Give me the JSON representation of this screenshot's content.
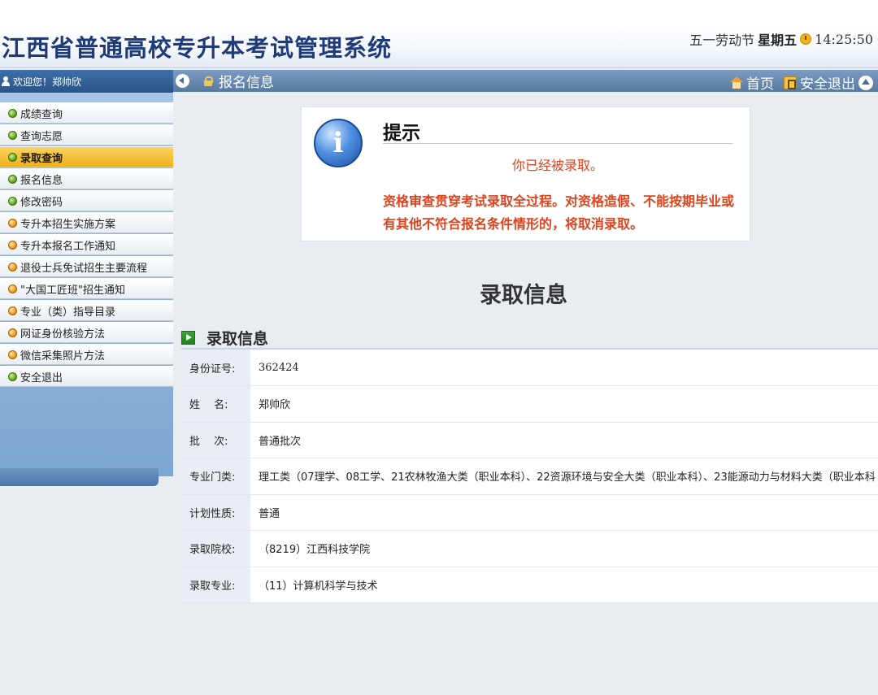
{
  "header": {
    "title": "江西省普通高校专升本考试管理系统",
    "holiday": "五一劳动节",
    "weekday": "星期五",
    "time": "14:25:50"
  },
  "sidebar": {
    "welcome": "欢迎您！郑帅欣",
    "items": [
      {
        "label": "成绩查询",
        "bullet": "green"
      },
      {
        "label": "查询志愿",
        "bullet": "green"
      },
      {
        "label": "录取查询",
        "bullet": "green",
        "active": true
      },
      {
        "label": "报名信息",
        "bullet": "green"
      },
      {
        "label": "修改密码",
        "bullet": "green"
      },
      {
        "label": "专升本招生实施方案",
        "bullet": "orange"
      },
      {
        "label": "专升本报名工作通知",
        "bullet": "orange"
      },
      {
        "label": "退役士兵免试招生主要流程",
        "bullet": "orange"
      },
      {
        "label": "\"大国工匠班\"招生通知",
        "bullet": "orange"
      },
      {
        "label": "专业（类）指导目录",
        "bullet": "orange"
      },
      {
        "label": "网证身份核验方法",
        "bullet": "orange"
      },
      {
        "label": "微信采集照片方法",
        "bullet": "orange"
      },
      {
        "label": "安全退出",
        "bullet": "green"
      }
    ]
  },
  "content_bar": {
    "breadcrumb": "报名信息",
    "home": "首页",
    "logout": "安全退出"
  },
  "notice": {
    "title": "提示",
    "message": "你已经被录取。",
    "detail": "资格审查贯穿考试录取全过程。对资格造假、不能按期毕业或有其他不符合报名条件情形的，将取消录取。"
  },
  "page_heading": "录取信息",
  "admission": {
    "section_title": "录取信息",
    "rows": [
      {
        "label": "身份证号:",
        "value": "362424"
      },
      {
        "label": "姓　 名:",
        "value": "郑帅欣"
      },
      {
        "label": "批　 次:",
        "value": "普通批次"
      },
      {
        "label": "专业门类:",
        "value": "理工类（07理学、08工学、21农林牧渔大类（职业本科）、22资源环境与安全大类（职业本科）、23能源动力与材料大类（职业本科"
      },
      {
        "label": "计划性质:",
        "value": "普通"
      },
      {
        "label": "录取院校:",
        "value": "（8219）江西科技学院"
      },
      {
        "label": "录取专业:",
        "value": "（11）计算机科学与技术"
      }
    ]
  },
  "colors": {
    "header_title": "#1f3c78",
    "active_menu": "#f0b11c",
    "notice_text": "#e0421b",
    "bar_bg": "#58799f"
  }
}
